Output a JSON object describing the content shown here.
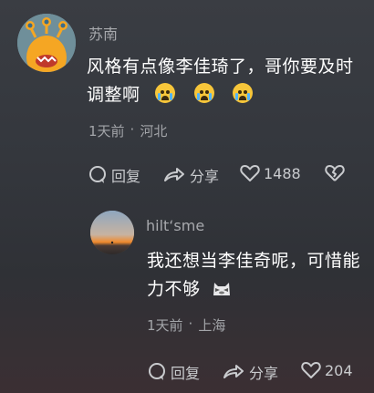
{
  "comment1": {
    "username": "苏南",
    "text_line1": "风格有点像李佳琦了，哥你要及时",
    "text_line2": "调整啊",
    "emojis": [
      "crying-face-emoji",
      "crying-face-emoji",
      "crying-face-emoji"
    ],
    "time": "1天前",
    "separator": "·",
    "location": "河北",
    "reply_label": "回复",
    "share_label": "分享",
    "like_count": "1488"
  },
  "comment2": {
    "username": "hilt‘sme",
    "text_line1": "我还想当李佳奇呢，可惜能",
    "text_line2": "力不够",
    "emojis": [
      "cat-emoji"
    ],
    "time": "1天前",
    "separator": "·",
    "location": "上海",
    "reply_label": "回复",
    "share_label": "分享",
    "like_count": "204"
  },
  "colors": {
    "avatar1_bg": "#6f8f9a",
    "monster_body": "#f5a623",
    "text_primary": "#ffffff",
    "text_secondary": "#a7a9ad"
  }
}
